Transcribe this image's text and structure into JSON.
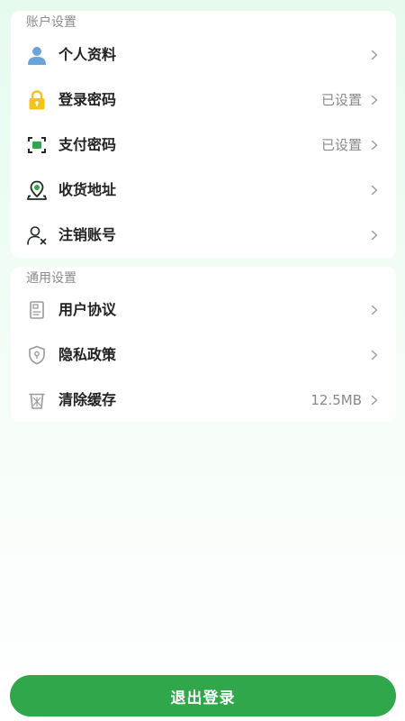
{
  "account_section": {
    "title": "账户设置",
    "items": [
      {
        "label": "个人资料",
        "value": "",
        "icon": "profile-icon"
      },
      {
        "label": "登录密码",
        "value": "已设置",
        "icon": "lock-icon"
      },
      {
        "label": "支付密码",
        "value": "已设置",
        "icon": "scan-frame-icon"
      },
      {
        "label": "收货地址",
        "value": "",
        "icon": "location-pin-icon"
      },
      {
        "label": "注销账号",
        "value": "",
        "icon": "user-remove-icon"
      }
    ]
  },
  "general_section": {
    "title": "通用设置",
    "items": [
      {
        "label": "用户协议",
        "value": "",
        "icon": "document-icon"
      },
      {
        "label": "隐私政策",
        "value": "",
        "icon": "shield-icon"
      },
      {
        "label": "清除缓存",
        "value": "12.5MB",
        "icon": "trash-icon"
      }
    ]
  },
  "logout_label": "退出登录",
  "colors": {
    "accent": "#2fa74a",
    "lock_yellow": "#f5c318",
    "profile_blue": "#6aa4d8",
    "icon_gray": "#8a8a8a"
  }
}
